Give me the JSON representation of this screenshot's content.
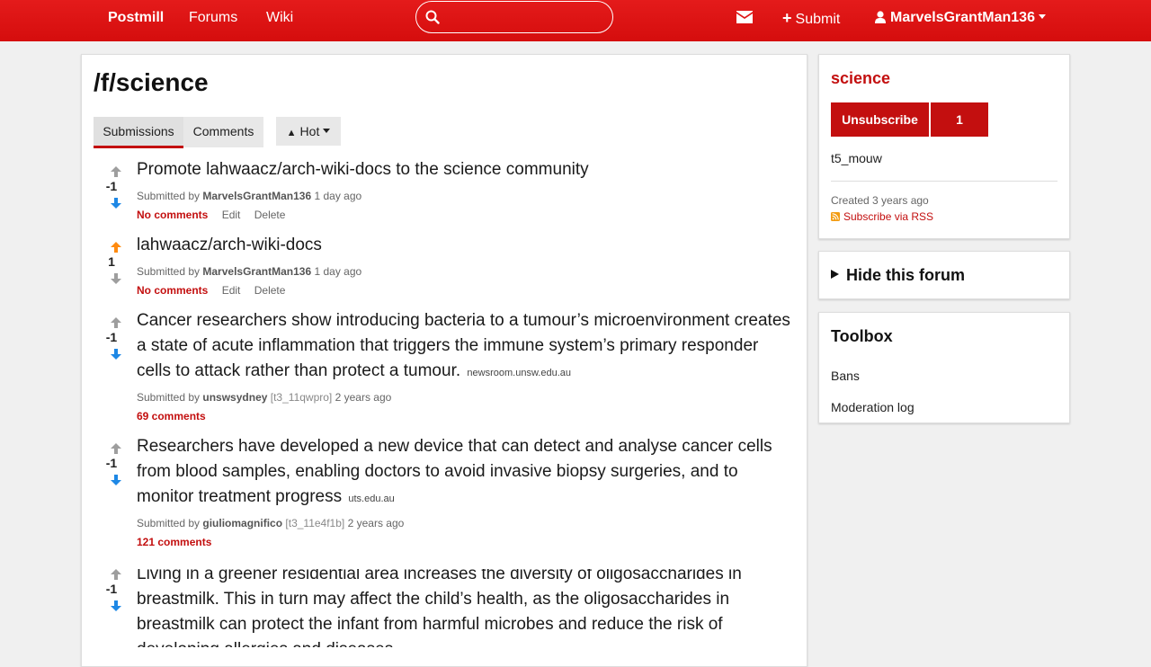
{
  "nav": {
    "brand": "Postmill",
    "forums": "Forums",
    "wiki": "Wiki",
    "search_placeholder": "",
    "submit": "Submit",
    "user": "MarvelsGrantMan136"
  },
  "page": {
    "title": "/f/science",
    "tabs": [
      "Submissions",
      "Comments"
    ],
    "sort": "Hot"
  },
  "submissions": [
    {
      "score": "-1",
      "vote_state": "down",
      "title": "Promote lahwaacz/arch-wiki-docs to the science community",
      "domain": "",
      "submitted_by": "Submitted by",
      "author": "MarvelsGrantMan136",
      "flair": "",
      "time": "1 day ago",
      "comments": "No comments",
      "edit": "Edit",
      "delete": "Delete"
    },
    {
      "score": "1",
      "vote_state": "up",
      "title": "lahwaacz/arch-wiki-docs",
      "domain": "",
      "submitted_by": "Submitted by",
      "author": "MarvelsGrantMan136",
      "flair": "",
      "time": "1 day ago",
      "comments": "No comments",
      "edit": "Edit",
      "delete": "Delete"
    },
    {
      "score": "-1",
      "vote_state": "down",
      "title": "Cancer researchers show introducing bacteria to a tumour’s microenvironment creates a state of acute inflammation that triggers the immune system’s primary responder cells to attack rather than protect a tumour.",
      "domain": "newsroom.unsw.edu.au",
      "submitted_by": "Submitted by",
      "author": "unswsydney",
      "flair": "[t3_11qwpro]",
      "time": "2 years ago",
      "comments": "69 comments"
    },
    {
      "score": "-1",
      "vote_state": "down",
      "title": "Researchers have developed a new device that can detect and analyse cancer cells from blood samples, enabling doctors to avoid invasive biopsy surgeries, and to monitor treatment progress",
      "domain": "uts.edu.au",
      "submitted_by": "Submitted by",
      "author": "giuliomagnifico",
      "flair": "[t3_11e4f1b]",
      "time": "2 years ago",
      "comments": "121 comments"
    },
    {
      "score": "-1",
      "vote_state": "down",
      "title": "Living in a greener residential area increases the diversity of oligosaccharides in breastmilk. This in turn may affect the child’s health, as the oligosaccharides in breastmilk can protect the infant from harmful microbes and reduce the risk of developing allergies and diseases."
    }
  ],
  "sidebar": {
    "forum_name": "science",
    "unsubscribe": "Unsubscribe",
    "subscriber_count": "1",
    "description": "t5_mouw",
    "created": "Created 3 years ago",
    "rss": "Subscribe via RSS",
    "hide_forum": "Hide this forum",
    "toolbox_title": "Toolbox",
    "toolbox_links": [
      "Bans",
      "Moderation log"
    ]
  },
  "colors": {
    "brand": "#e11414",
    "accent": "#c30f0f",
    "upvoted": "#ff8b10",
    "downvoted": "#1e88e5",
    "neutral_arrow": "#9e9e9e"
  },
  "icons": [
    "search-icon",
    "envelope-icon",
    "plus-icon",
    "user-icon",
    "caret-down-icon",
    "sort-icon",
    "upvote-icon",
    "downvote-icon",
    "rss-icon",
    "triangle-right-icon"
  ]
}
